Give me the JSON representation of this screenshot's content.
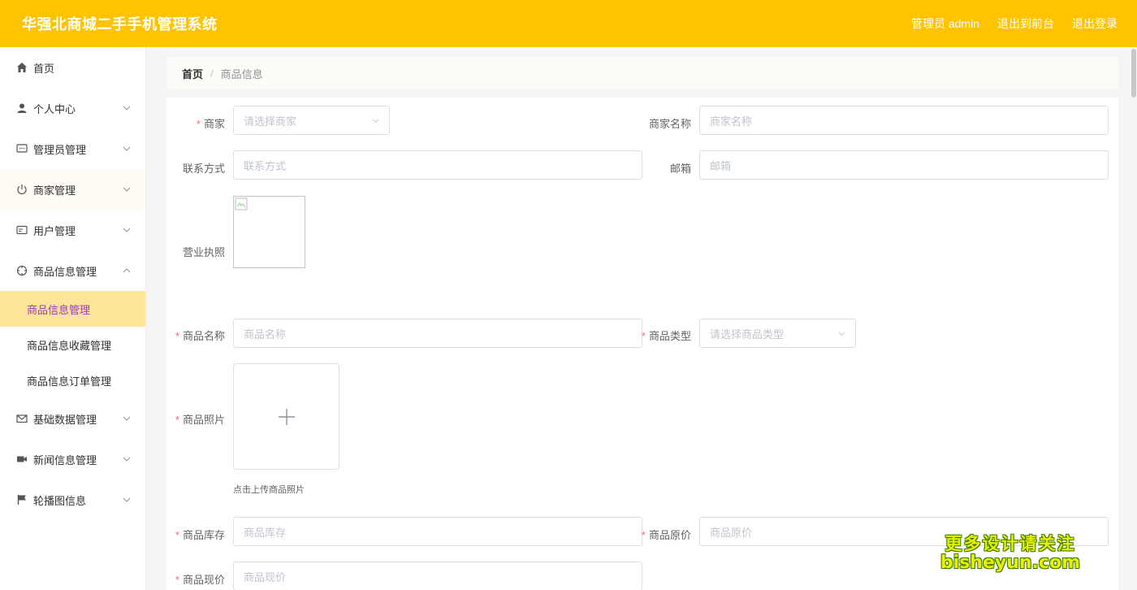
{
  "header": {
    "app_title": "华强北商城二手手机管理系统",
    "admin_label": "管理员 admin",
    "front_label": "退出到前台",
    "logout_label": "退出登录"
  },
  "sidebar": {
    "home": "首页",
    "personal": "个人中心",
    "admin_mgmt": "管理员管理",
    "merchant_mgmt": "商家管理",
    "user_mgmt": "用户管理",
    "goods_mgmt": "商品信息管理",
    "sub_goods": "商品信息管理",
    "sub_fav": "商品信息收藏管理",
    "sub_order": "商品信息订单管理",
    "base_data": "基础数据管理",
    "news": "新闻信息管理",
    "carousel": "轮播图信息"
  },
  "breadcrumb": {
    "home": "首页",
    "separator": "/",
    "current": "商品信息"
  },
  "form": {
    "merchant_label": "商家",
    "merchant_placeholder": "请选择商家",
    "merchant_name_label": "商家名称",
    "merchant_name_placeholder": "商家名称",
    "contact_label": "联系方式",
    "contact_placeholder": "联系方式",
    "email_label": "邮箱",
    "email_placeholder": "邮箱",
    "license_label": "营业执照",
    "goods_name_label": "商品名称",
    "goods_name_placeholder": "商品名称",
    "goods_type_label": "商品类型",
    "goods_type_placeholder": "请选择商品类型",
    "goods_photo_label": "商品照片",
    "upload_hint": "点击上传商品照片",
    "stock_label": "商品库存",
    "stock_placeholder": "商品库存",
    "orig_price_label": "商品原价",
    "orig_price_placeholder": "商品原价",
    "cur_price_label": "商品现价",
    "cur_price_placeholder": "商品现价",
    "required_mark": "*"
  },
  "watermark": {
    "line1": "更多设计请关注",
    "line2": "bisheyun.com"
  },
  "colors": {
    "header_bg": "#ffc300",
    "active_submenu_bg": "#ffe599",
    "active_submenu_text": "#9a35c9",
    "required": "#f56c6c"
  }
}
